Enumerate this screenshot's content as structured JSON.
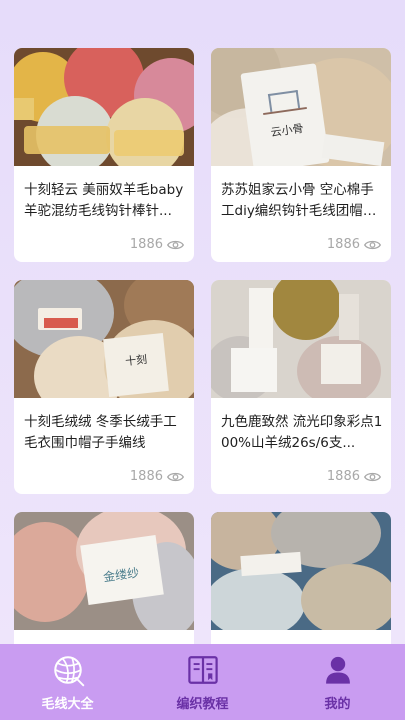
{
  "products": [
    {
      "title": "十刻轻云 美丽奴羊毛baby羊驼混纺毛线钩针棒针...",
      "views": "1886",
      "image": "yarn-skeins-yellow-pink-gray"
    },
    {
      "title": "苏苏姐家云小骨 空心棉手工diy编织钩针毛线团帽子...",
      "views": "1886",
      "image": "yarn-skein-cloud-bone-beige",
      "brand_label": "云小骨"
    },
    {
      "title": "十刻毛绒绒 冬季长绒手工毛衣围巾帽子手编线",
      "views": "1886",
      "image": "yarn-fluffy-gray-cream",
      "brand_label": "十刻"
    },
    {
      "title": "九色鹿致然 流光印象彩点100%山羊绒26s/6支...",
      "views": "1886",
      "image": "yarn-speckled-olive-pink"
    },
    {
      "title": "",
      "views": "",
      "image": "yarn-mohair-pink-gray",
      "brand_label": "金缕纱"
    },
    {
      "title": "",
      "views": "",
      "image": "yarn-tweed-blue-beige"
    }
  ],
  "tabbar": {
    "tabs": [
      {
        "label": "毛线大全",
        "icon": "yarn-ball-icon",
        "active": true
      },
      {
        "label": "编织教程",
        "icon": "book-icon",
        "active": false
      },
      {
        "label": "我的",
        "icon": "user-icon",
        "active": false
      }
    ]
  },
  "colors": {
    "tab_bg": "#c99cf1",
    "tab_active": "#ffffff",
    "tab_inactive": "#6a31a6",
    "background": "#e6dcfa"
  }
}
